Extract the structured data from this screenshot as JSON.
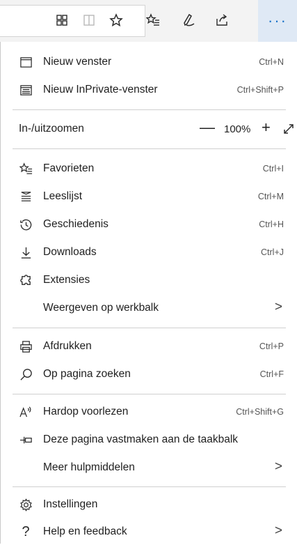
{
  "toolbar": {
    "icons": [
      "extension-puzzle-icon",
      "reading-view-icon",
      "favorite-star-icon",
      "favorites-list-icon",
      "pen-icon",
      "share-icon"
    ],
    "more_label": "···"
  },
  "menu": {
    "new_window": {
      "label": "Nieuw venster",
      "shortcut": "Ctrl+N"
    },
    "new_private": {
      "label": "Nieuw InPrivate-venster",
      "shortcut": "Ctrl+Shift+P"
    },
    "zoom": {
      "label": "In-/uitzoomen",
      "minus": "—",
      "value": "100%",
      "plus": "+"
    },
    "favorites": {
      "label": "Favorieten",
      "shortcut": "Ctrl+I"
    },
    "reading_list": {
      "label": "Leeslijst",
      "shortcut": "Ctrl+M"
    },
    "history": {
      "label": "Geschiedenis",
      "shortcut": "Ctrl+H"
    },
    "downloads": {
      "label": "Downloads",
      "shortcut": "Ctrl+J"
    },
    "extensions": {
      "label": "Extensies"
    },
    "show_toolbar": {
      "label": "Weergeven op werkbalk",
      "chevron": ">"
    },
    "print": {
      "label": "Afdrukken",
      "shortcut": "Ctrl+P"
    },
    "find": {
      "label": "Op pagina zoeken",
      "shortcut": "Ctrl+F"
    },
    "read_aloud": {
      "label": "Hardop voorlezen",
      "shortcut": "Ctrl+Shift+G"
    },
    "pin": {
      "label": "Deze pagina vastmaken aan de taakbalk"
    },
    "more_tools": {
      "label": "Meer hulpmiddelen",
      "chevron": ">"
    },
    "settings": {
      "label": "Instellingen"
    },
    "help": {
      "label": "Help en feedback",
      "chevron": ">"
    }
  }
}
